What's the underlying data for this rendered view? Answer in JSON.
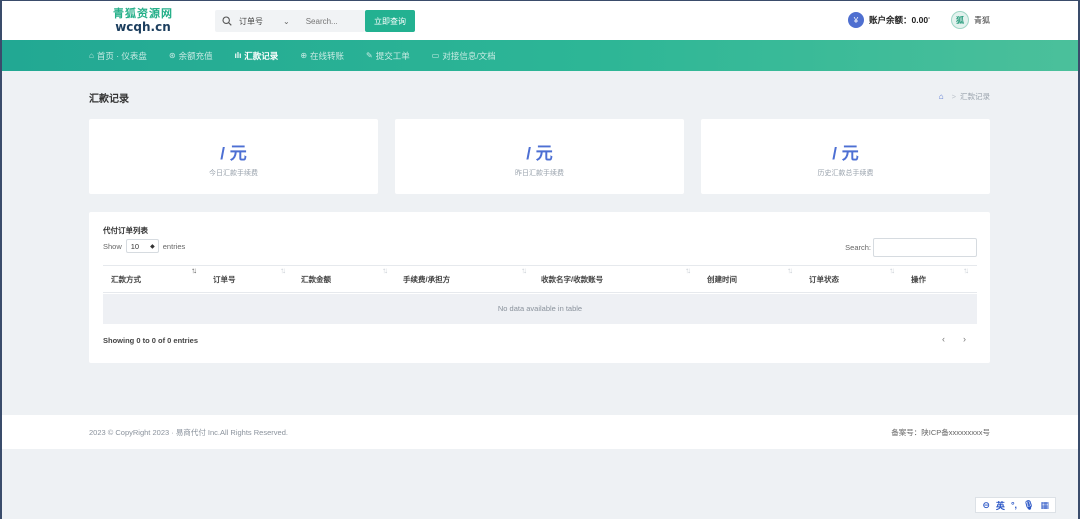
{
  "header": {
    "logo_cn": "青狐资源网",
    "logo_en": "wcqh.cn",
    "search_select": "订单号",
    "search_placeholder": "Search...",
    "query_button": "立即查询",
    "balance_label": "账户余额：",
    "balance_value": "0.00",
    "balance_sup": "¥",
    "username": "青狐",
    "avatar_text": "狐"
  },
  "nav": {
    "items": [
      {
        "label": "首页 · 仪表盘",
        "icon": "⌂"
      },
      {
        "label": "余额充值",
        "icon": "⊛"
      },
      {
        "label": "汇款记录",
        "icon": "ılı"
      },
      {
        "label": "在线转账",
        "icon": "⊕"
      },
      {
        "label": "提交工单",
        "icon": "✎"
      },
      {
        "label": "对接信息/文档",
        "icon": "▭"
      }
    ]
  },
  "page": {
    "title": "汇款记录",
    "breadcrumb_current": "汇款记录",
    "breadcrumb_sep": ">"
  },
  "stats": [
    {
      "value": "/ 元",
      "label": "今日汇款手续费"
    },
    {
      "value": "/ 元",
      "label": "昨日汇款手续费"
    },
    {
      "value": "/ 元",
      "label": "历史汇款总手续费"
    }
  ],
  "table": {
    "title": "代付订单列表",
    "show_label": "Show",
    "length_value": "10",
    "entries_label": "entries",
    "search_label": "Search:",
    "columns": [
      "汇款方式",
      "订单号",
      "汇款金额",
      "手续费/承担方",
      "收款名字/收款账号",
      "创建时间",
      "订单状态",
      "操作"
    ],
    "empty_text": "No data available in table",
    "info_text": "Showing 0 to 0 of 0 entries",
    "prev": "‹",
    "next": "›"
  },
  "footer": {
    "copyright": "2023 © CopyRight 2023 · 易商代付 Inc.All Rights Reserved.",
    "icp": "备案号：陕ICP备xxxxxxxxx号"
  },
  "ime": {
    "lang": "英",
    "items": [
      "°,",
      "🎙",
      "▦"
    ]
  },
  "colors": {
    "accent": "#23b191",
    "blue": "#4d6fd3"
  }
}
